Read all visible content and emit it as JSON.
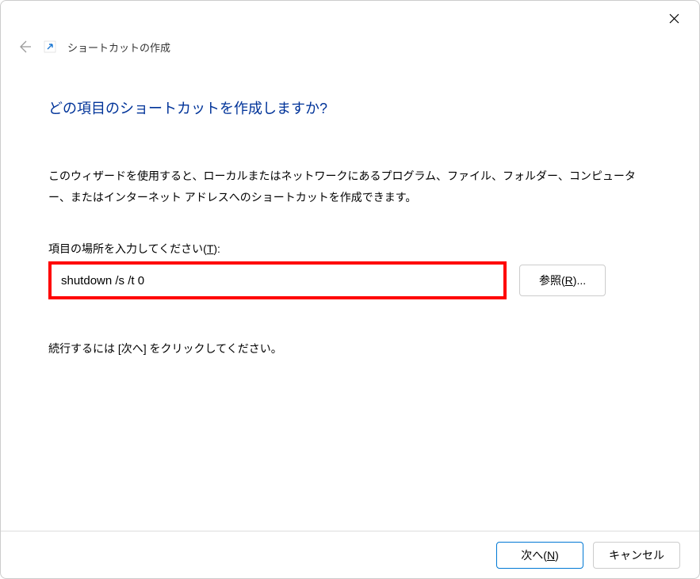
{
  "titlebar": {
    "close": "✕"
  },
  "header": {
    "title": "ショートカットの作成"
  },
  "main": {
    "heading": "どの項目のショートカットを作成しますか?",
    "description": "このウィザードを使用すると、ローカルまたはネットワークにあるプログラム、ファイル、フォルダー、コンピューター、またはインターネット アドレスへのショートカットを作成できます。",
    "field_label_pre": "項目の場所を入力してください(",
    "field_label_key": "T",
    "field_label_post": "):",
    "location_value": "shutdown /s /t 0",
    "browse_pre": "参照(",
    "browse_key": "R",
    "browse_post": ")...",
    "continue_text": "続行するには [次へ] をクリックしてください。"
  },
  "footer": {
    "next_pre": "次へ(",
    "next_key": "N",
    "next_post": ")",
    "cancel": "キャンセル"
  }
}
